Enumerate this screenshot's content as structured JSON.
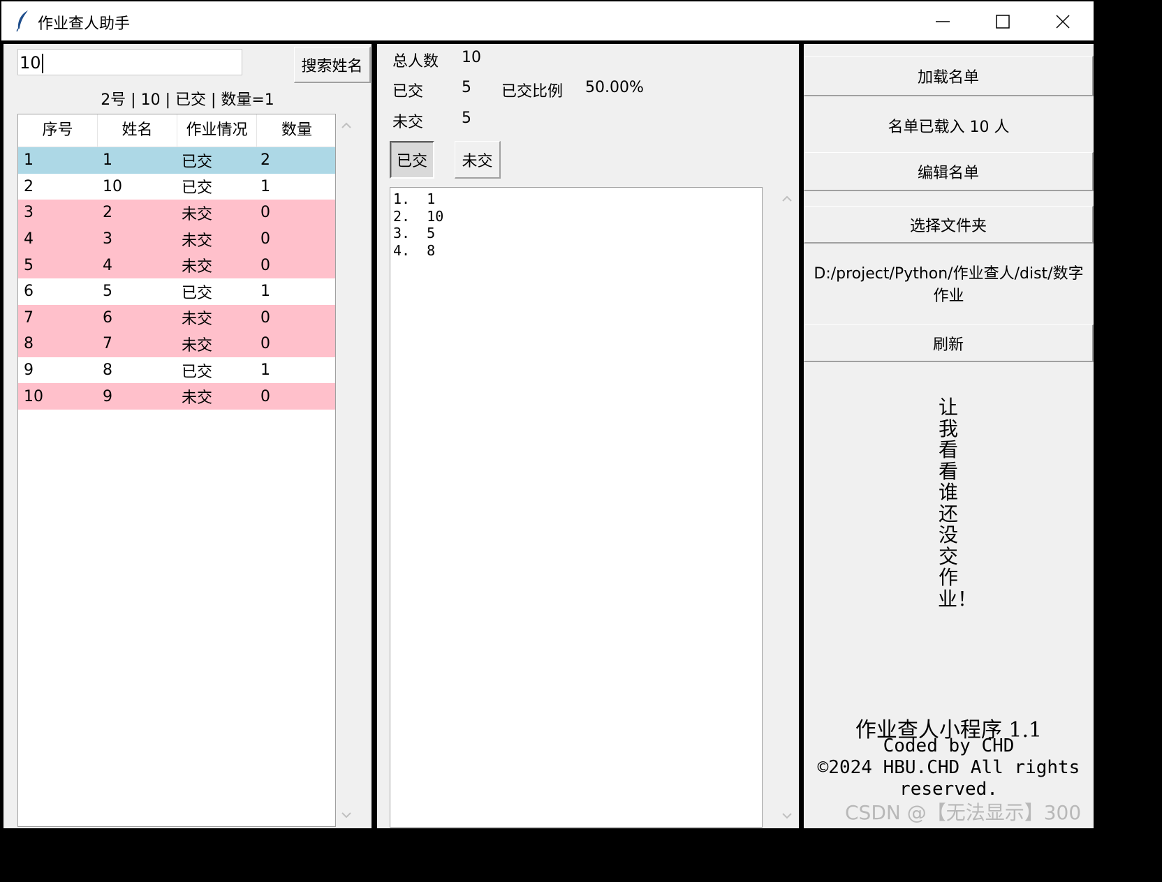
{
  "window": {
    "title": "作业查人助手"
  },
  "search": {
    "value": "10",
    "button_label": "搜索姓名",
    "result": "2号 | 10 | 已交 | 数量=1"
  },
  "table": {
    "columns": [
      "序号",
      "姓名",
      "作业情况",
      "数量"
    ],
    "rows": [
      {
        "no": "1",
        "name": "1",
        "status": "已交",
        "count": "2",
        "style": "selected"
      },
      {
        "no": "2",
        "name": "10",
        "status": "已交",
        "count": "1",
        "style": "white"
      },
      {
        "no": "3",
        "name": "2",
        "status": "未交",
        "count": "0",
        "style": "pink"
      },
      {
        "no": "4",
        "name": "3",
        "status": "未交",
        "count": "0",
        "style": "pink"
      },
      {
        "no": "5",
        "name": "4",
        "status": "未交",
        "count": "0",
        "style": "pink"
      },
      {
        "no": "6",
        "name": "5",
        "status": "已交",
        "count": "1",
        "style": "white"
      },
      {
        "no": "7",
        "name": "6",
        "status": "未交",
        "count": "0",
        "style": "pink"
      },
      {
        "no": "8",
        "name": "7",
        "status": "未交",
        "count": "0",
        "style": "pink"
      },
      {
        "no": "9",
        "name": "8",
        "status": "已交",
        "count": "1",
        "style": "white"
      },
      {
        "no": "10",
        "name": "9",
        "status": "未交",
        "count": "0",
        "style": "pink"
      }
    ]
  },
  "stats": {
    "total_label": "总人数",
    "total_value": "10",
    "submitted_label": "已交",
    "submitted_value": "5",
    "ratio_label": "已交比例",
    "ratio_value": "50.00%",
    "unsubmitted_label": "未交",
    "unsubmitted_value": "5"
  },
  "toggles": {
    "submitted": "已交",
    "unsubmitted": "未交"
  },
  "list": [
    "1.  1",
    "2.  10",
    "3.  5",
    "4.  8"
  ],
  "right": {
    "load_button": "加载名单",
    "loaded_status": "名单已载入 10 人",
    "edit_button": "编辑名单",
    "folder_button": "选择文件夹",
    "folder_path": "D:/project/Python/作业查人/dist/数字作业",
    "refresh_button": "刷新",
    "slogan": "让我看看谁还没交作业！",
    "footer_line1": "作业查人小程序 1.1",
    "footer_line2": "Coded by CHD",
    "footer_line3": "©2024 HBU.CHD All rights reserved."
  },
  "watermark": "CSDN @【无法显示】300",
  "colors": {
    "selected_row": "#add8e6",
    "unsubmitted_row": "#ffc0cb",
    "background": "#f0f0f0"
  },
  "icons": [
    "feather-icon",
    "minimize-icon",
    "maximize-icon",
    "close-icon",
    "scroll-up-icon",
    "scroll-down-icon"
  ]
}
